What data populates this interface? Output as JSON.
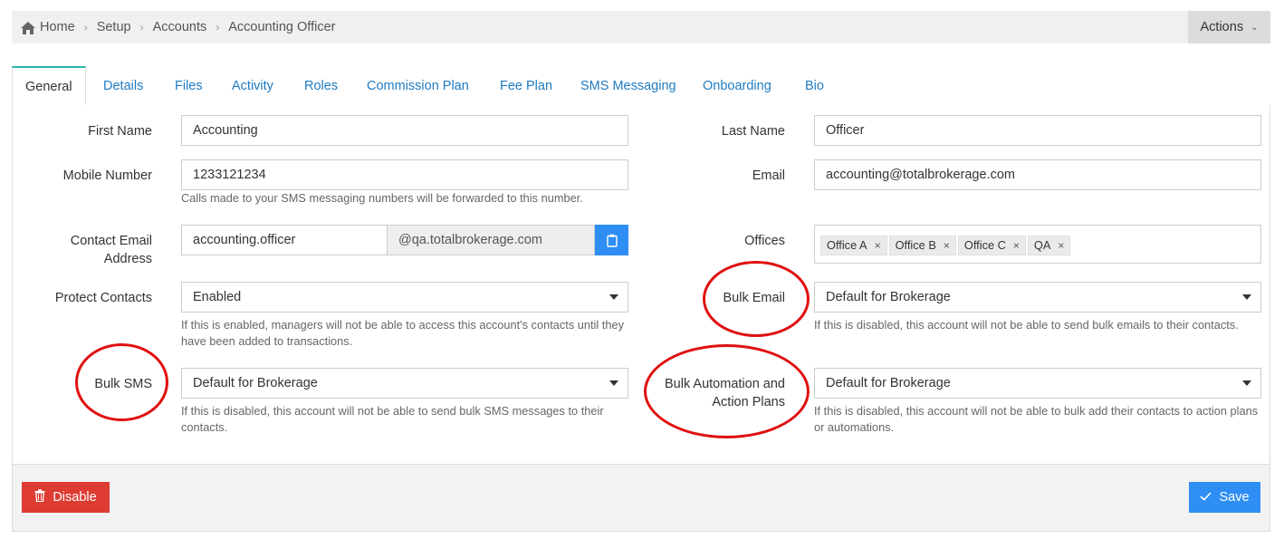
{
  "breadcrumb": {
    "items": [
      "Home",
      "Setup",
      "Accounts",
      "Accounting Officer"
    ],
    "home_icon": "home-icon"
  },
  "actions": {
    "label": "Actions"
  },
  "tabs": [
    "General",
    "Details",
    "Files",
    "Activity",
    "Roles",
    "Commission Plan",
    "Fee Plan",
    "SMS Messaging",
    "Onboarding",
    "Bio"
  ],
  "active_tab": "General",
  "form": {
    "first_name": {
      "label": "First Name",
      "value": "Accounting"
    },
    "last_name": {
      "label": "Last Name",
      "value": "Officer"
    },
    "mobile": {
      "label": "Mobile Number",
      "value": "1233121234",
      "help": "Calls made to your SMS messaging numbers will be forwarded to this number."
    },
    "email": {
      "label": "Email",
      "value": "accounting@totalbrokerage.com"
    },
    "contact_email": {
      "label_line1": "Contact Email",
      "label_line2": "Address",
      "value": "accounting.officer",
      "domain": "@qa.totalbrokerage.com"
    },
    "offices": {
      "label": "Offices",
      "tags": [
        "Office A",
        "Office B",
        "Office C",
        "QA"
      ]
    },
    "protect_contacts": {
      "label": "Protect Contacts",
      "value": "Enabled",
      "help": "If this is enabled, managers will not be able to access this account's contacts until they have been added to transactions."
    },
    "bulk_email": {
      "label": "Bulk Email",
      "value": "Default for Brokerage",
      "help": "If this is disabled, this account will not be able to send bulk emails to their contacts."
    },
    "bulk_sms": {
      "label": "Bulk SMS",
      "value": "Default for Brokerage",
      "help": "If this is disabled, this account will not be able to send bulk SMS messages to their contacts."
    },
    "bulk_automation": {
      "label_line1": "Bulk Automation and",
      "label_line2": "Action Plans",
      "value": "Default for Brokerage",
      "help": "If this is disabled, this account will not be able to bulk add their contacts to action plans or automations."
    }
  },
  "footer": {
    "disable_label": "Disable",
    "save_label": "Save"
  },
  "colors": {
    "accent": "#2f8ef4",
    "danger": "#de3b33",
    "tab_link": "#1f7bc1",
    "highlight_circle": "#e01010"
  }
}
